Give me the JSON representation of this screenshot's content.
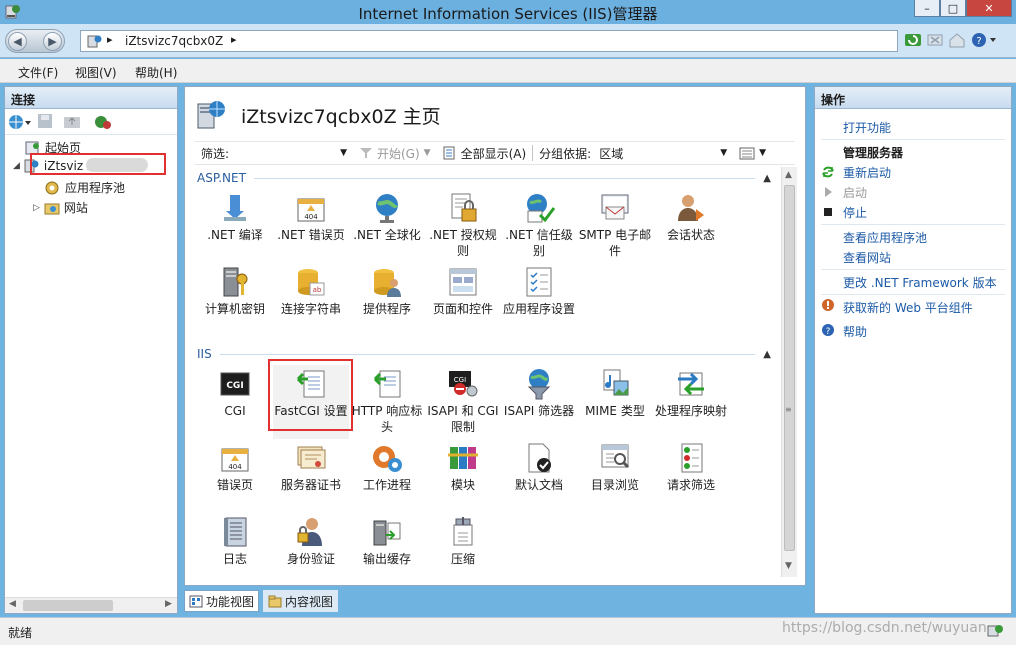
{
  "window": {
    "title": "Internet Information Services (IIS)管理器"
  },
  "window_controls": {
    "minimize": "–",
    "maximize": "□",
    "close": "✕"
  },
  "address_bar": {
    "crumb": "iZtsvizc7qcbx0Z"
  },
  "menu": [
    "文件(F)",
    "视图(V)",
    "帮助(H)"
  ],
  "connections": {
    "header": "连接",
    "tree": [
      {
        "label": "起始页"
      },
      {
        "label": "iZtsviz            Z (IZTSV"
      },
      {
        "label": "应用程序池"
      },
      {
        "label": "网站"
      }
    ]
  },
  "center": {
    "title": "iZtsvizc7qcbx0Z 主页",
    "filter_label": "筛选:",
    "start_label": "开始(G)",
    "show_all_label": "全部显示(A)",
    "group_by_label": "分组依据:",
    "group_by_value": "区域",
    "groups": [
      {
        "name": "ASP.NET",
        "items": [
          {
            "label": ".NET 编译",
            "icon": "dotnet-compile-icon"
          },
          {
            "label": ".NET 错误页",
            "icon": "error-404-icon"
          },
          {
            "label": ".NET 全球化",
            "icon": "globe-icon"
          },
          {
            "label": ".NET 授权规则",
            "icon": "lock-document-icon"
          },
          {
            "label": ".NET 信任级别",
            "icon": "trust-icon"
          },
          {
            "label": "SMTP 电子邮件",
            "icon": "mail-icon"
          },
          {
            "label": "会话状态",
            "icon": "session-user-icon"
          },
          {
            "label": "计算机密钥",
            "icon": "machine-key-icon"
          },
          {
            "label": "连接字符串",
            "icon": "connection-string-icon"
          },
          {
            "label": "提供程序",
            "icon": "providers-icon"
          },
          {
            "label": "页面和控件",
            "icon": "pages-controls-icon"
          },
          {
            "label": "应用程序设置",
            "icon": "app-settings-icon"
          }
        ]
      },
      {
        "name": "IIS",
        "items": [
          {
            "label": "CGI",
            "icon": "cgi-icon"
          },
          {
            "label": "FastCGI 设置",
            "icon": "fastcgi-icon"
          },
          {
            "label": "HTTP 响应标头",
            "icon": "http-headers-icon"
          },
          {
            "label": "ISAPI 和 CGI 限制",
            "icon": "isapi-cgi-restrictions-icon"
          },
          {
            "label": "ISAPI 筛选器",
            "icon": "isapi-filters-icon"
          },
          {
            "label": "MIME 类型",
            "icon": "mime-types-icon"
          },
          {
            "label": "处理程序映射",
            "icon": "handler-mappings-icon"
          },
          {
            "label": "错误页",
            "icon": "error-pages-icon"
          },
          {
            "label": "服务器证书",
            "icon": "server-certificates-icon"
          },
          {
            "label": "工作进程",
            "icon": "worker-processes-icon"
          },
          {
            "label": "模块",
            "icon": "modules-icon"
          },
          {
            "label": "默认文档",
            "icon": "default-document-icon"
          },
          {
            "label": "目录浏览",
            "icon": "directory-browsing-icon"
          },
          {
            "label": "请求筛选",
            "icon": "request-filtering-icon"
          },
          {
            "label": "日志",
            "icon": "logging-icon"
          },
          {
            "label": "身份验证",
            "icon": "authentication-icon"
          },
          {
            "label": "输出缓存",
            "icon": "output-caching-icon"
          },
          {
            "label": "压缩",
            "icon": "compression-icon"
          }
        ]
      }
    ],
    "view_tabs": [
      "功能视图",
      "内容视图"
    ]
  },
  "actions": {
    "header": "操作",
    "open_feature": "打开功能",
    "manage_server": "管理服务器",
    "restart": "重新启动",
    "start": "启动",
    "stop": "停止",
    "view_app_pools": "查看应用程序池",
    "view_sites": "查看网站",
    "change_framework": "更改 .NET Framework 版本",
    "get_web_platform": "获取新的 Web 平台组件",
    "help": "帮助"
  },
  "status": {
    "text": "就绪"
  },
  "watermark": "https://blog.csdn.net/wuyuan"
}
